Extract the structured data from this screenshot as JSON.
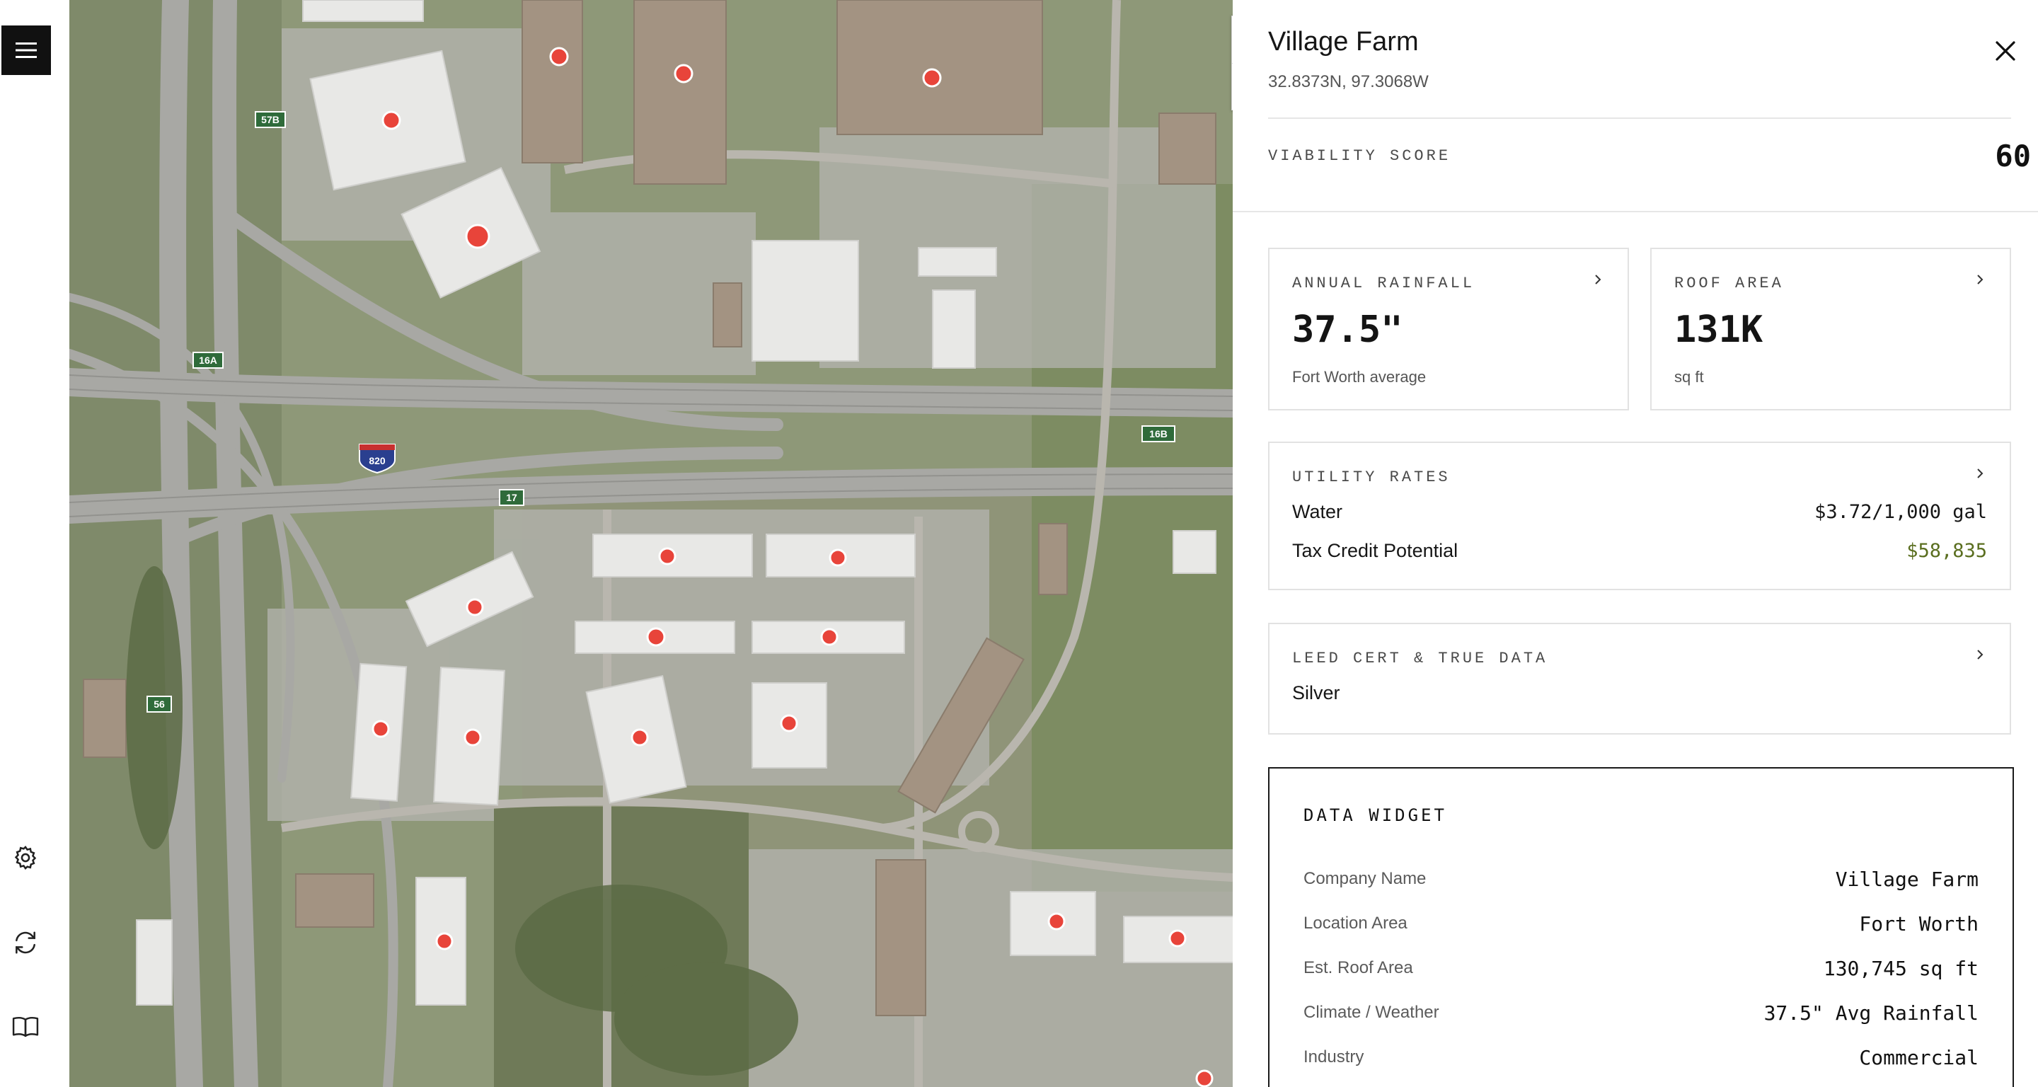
{
  "nav": {
    "menu_icon": "hamburger-menu-icon",
    "settings_icon": "gear-icon",
    "refresh_icon": "refresh-icon",
    "docs_icon": "book-icon"
  },
  "map": {
    "zoom_in": "+",
    "zoom_out": "−",
    "highway_labels": [
      "57B",
      "16A",
      "820",
      "16B",
      "17",
      "56"
    ],
    "marker_color": "#e8443a"
  },
  "panel": {
    "title": "Village Farm",
    "coordinates": "32.8373N, 97.3068W",
    "viability": {
      "label": "VIABILITY SCORE",
      "value": "60"
    },
    "annual_rainfall": {
      "label": "ANNUAL RAINFALL",
      "value": "37.5\"",
      "sub": "Fort Worth average"
    },
    "roof_area": {
      "label": "ROOF AREA",
      "value": "131K",
      "sub": "sq ft"
    },
    "utility_rates": {
      "label": "UTILITY RATES",
      "rows": [
        {
          "key": "Water",
          "value": "$3.72/1,000 gal"
        },
        {
          "key": "Tax Credit Potential",
          "value": "$58,835"
        }
      ]
    },
    "leed": {
      "label": "LEED CERT & TRUE DATA",
      "value": "Silver"
    },
    "widget": {
      "title": "DATA WIDGET",
      "rows": [
        {
          "key": "Company Name",
          "value": "Village Farm"
        },
        {
          "key": "Location Area",
          "value": "Fort Worth"
        },
        {
          "key": "Est. Roof Area",
          "value": "130,745 sq ft"
        },
        {
          "key": "Climate / Weather",
          "value": "37.5\" Avg Rainfall"
        },
        {
          "key": "Industry",
          "value": "Commercial"
        }
      ]
    }
  },
  "colors": {
    "accent_green": "#5a6e1f",
    "marker_red": "#e8443a"
  }
}
